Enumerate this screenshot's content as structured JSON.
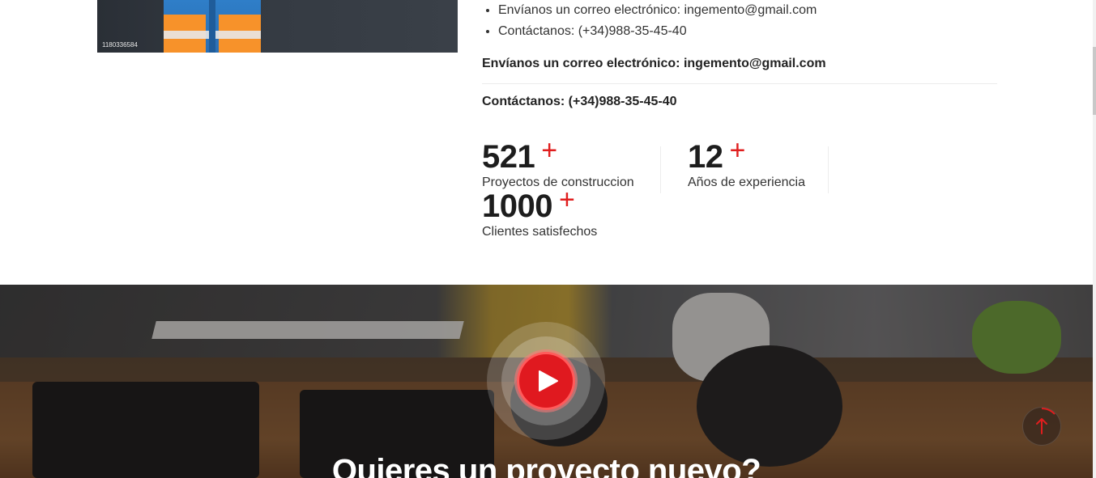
{
  "hero_image": {
    "image_id": "1180336584"
  },
  "contact_list": [
    "Envíanos un correo electrónico: ingemento@gmail.com",
    "Contáctanos: (+34)988-35-45-40"
  ],
  "contact_email_label": "Envíanos un correo electrónico: ingemento@gmail.com",
  "contact_phone_label": "Contáctanos: (+34)988-35-45-40",
  "counters": [
    {
      "value": "521",
      "suffix": "+",
      "label": "Proyectos de construccion"
    },
    {
      "value": "12",
      "suffix": "+",
      "label": "Años de experiencia"
    },
    {
      "value": "1000",
      "suffix": "+",
      "label": "Clientes satisfechos"
    }
  ],
  "video_section": {
    "title": "Quieres un proyecto nuevo?"
  },
  "colors": {
    "accent": "#e01e1e",
    "text": "#222222"
  },
  "icons": {
    "play": "play-icon",
    "back_to_top": "arrow-up-icon"
  }
}
